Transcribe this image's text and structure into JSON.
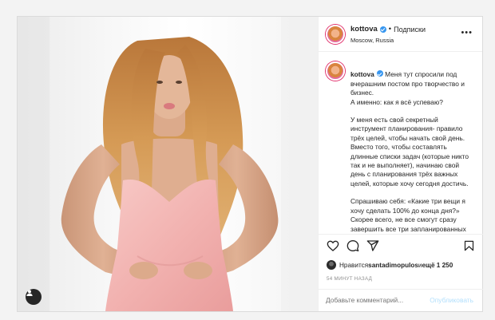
{
  "post": {
    "username": "kottova",
    "header_separator": "•",
    "follow_label": "Подписки",
    "location": "Moscow, Russia",
    "more_label": "•••"
  },
  "caption": {
    "username": "kottova",
    "paragraphs": [
      "Меня тут спросили под вчерашним постом про творчество и бизнес.\nА именно: как я всё успеваю?",
      "У меня есть свой секретный инструмент планирования- правило трёх целей, чтобы начать свой день.\nВместо того, чтобы составлять длинные списки задач (которые никто так и не выполняет), начинаю свой день с планирования трёх важных целей, которые хочу сегодня достичь.",
      "Спрашиваю себя: «Какие три вещи я хочу сделать 100% до конца дня?»\nСкорее всего, не все смогут сразу завершить все три запланированных"
    ]
  },
  "actions": {
    "like_icon": "heart-icon",
    "comment_icon": "comment-icon",
    "share_icon": "share-icon",
    "save_icon": "bookmark-icon"
  },
  "likes": {
    "prefix": "Нравится ",
    "user": "santadimopulos",
    "middle": " и ",
    "count": "ещё 1 250"
  },
  "timestamp": "54 МИНУТ НАЗАД",
  "comment": {
    "placeholder": "Добавьте комментарий...",
    "publish_label": "Опубликовать"
  },
  "colors": {
    "verified": "#3897f0",
    "publish_disabled": "#b2dffc",
    "dress": "#f4b9b8",
    "hair": "#c98a4a"
  }
}
